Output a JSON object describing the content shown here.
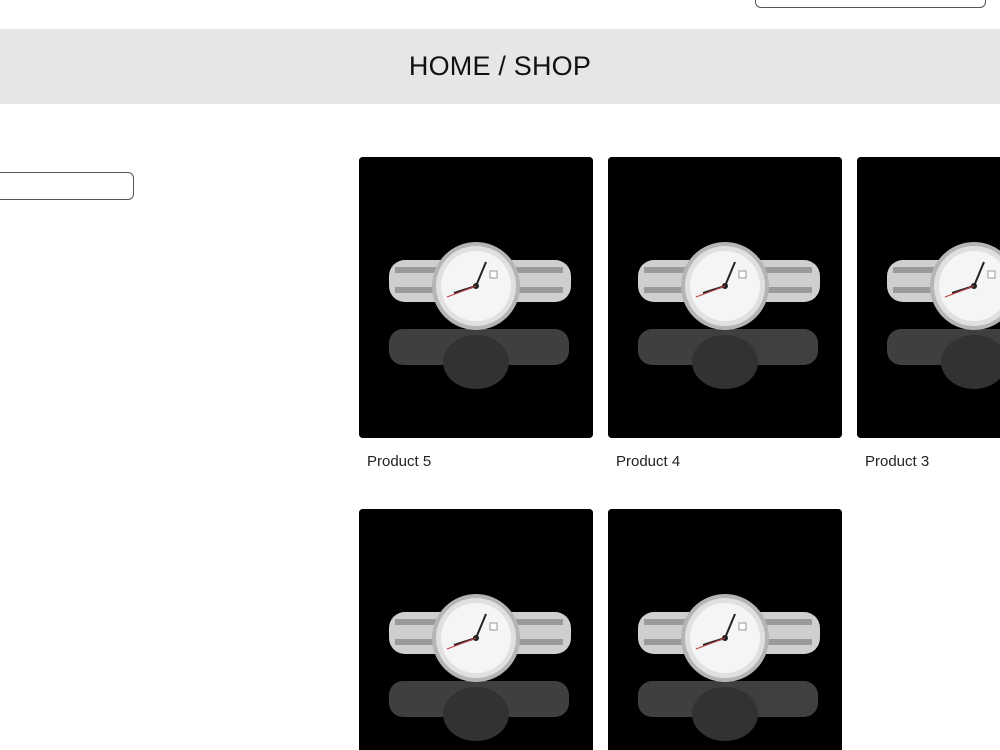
{
  "header": {
    "breadcrumb": "HOME / SHOP"
  },
  "products": [
    {
      "label": "Product 5",
      "image_icon": "wristwatch-image"
    },
    {
      "label": "Product 4",
      "image_icon": "wristwatch-image"
    },
    {
      "label": "Product 3",
      "image_icon": "wristwatch-image"
    },
    {
      "label": "",
      "image_icon": "wristwatch-image"
    },
    {
      "label": "",
      "image_icon": "wristwatch-image"
    }
  ],
  "colors": {
    "banner_bg": "#e6e6e9",
    "product_bg": "#000000"
  }
}
